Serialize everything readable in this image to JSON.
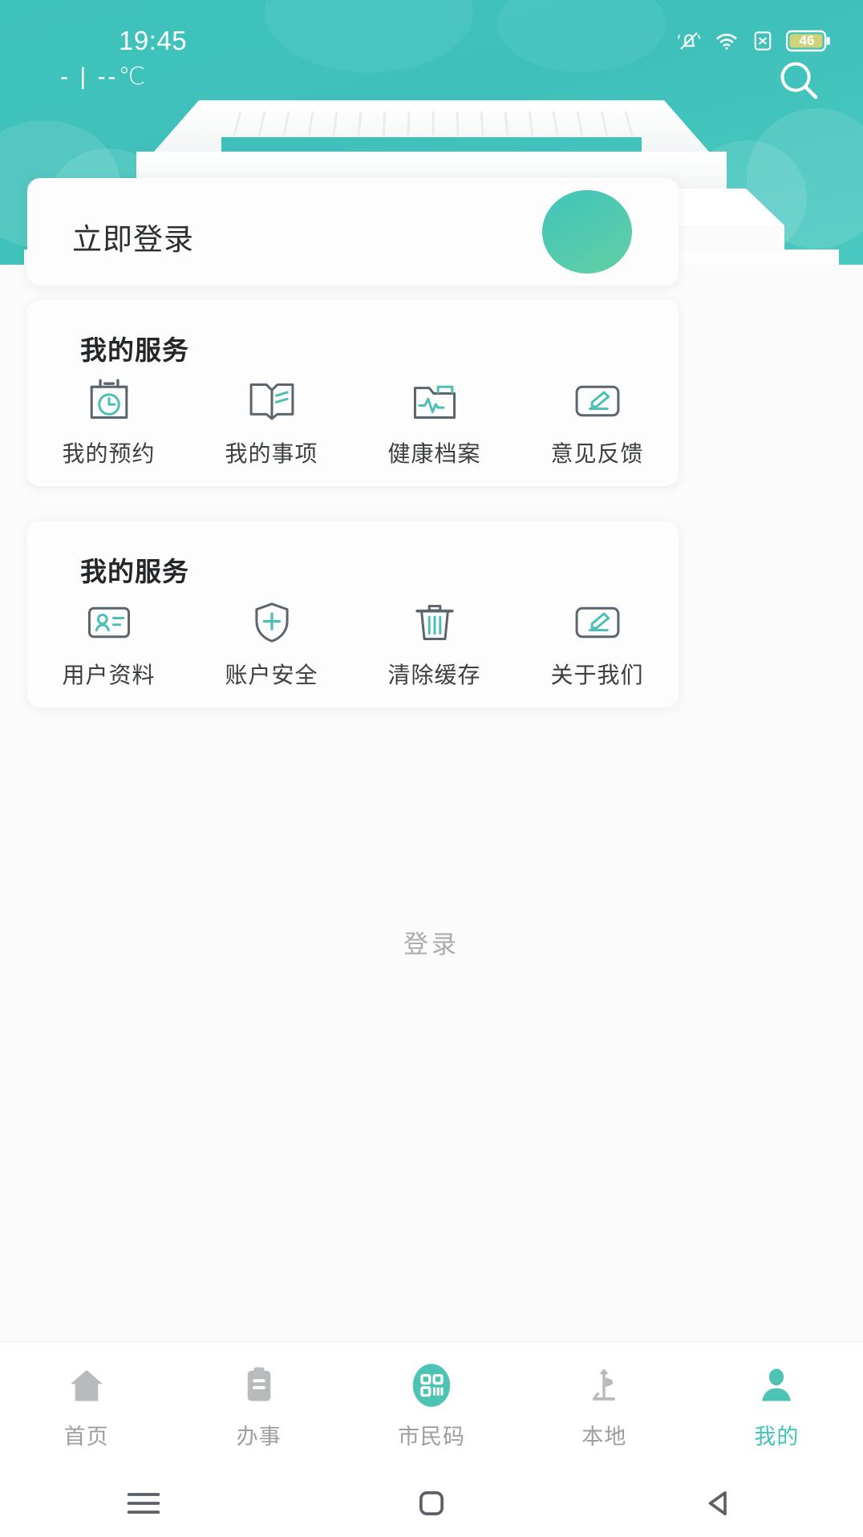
{
  "status_bar": {
    "time": "19:45",
    "battery_level": "46",
    "icons": [
      "mute-icon",
      "wifi-icon",
      "sim-card-icon",
      "battery-icon"
    ]
  },
  "header": {
    "weather": "- | --℃",
    "search_icon": "search-icon",
    "background_color": "#41c3bd",
    "decoration": "pavilion-silhouette"
  },
  "login_card": {
    "label": "立即登录",
    "avatar": "avatar-placeholder"
  },
  "services_card": {
    "title": "我的服务",
    "items": [
      {
        "label": "我的预约",
        "icon": "calendar-clock-icon"
      },
      {
        "label": "我的事项",
        "icon": "open-book-icon"
      },
      {
        "label": "健康档案",
        "icon": "folder-pulse-icon"
      },
      {
        "label": "意见反馈",
        "icon": "pencil-edit-icon"
      }
    ]
  },
  "settings_card": {
    "title": "我的服务",
    "items": [
      {
        "label": "用户资料",
        "icon": "id-card-icon"
      },
      {
        "label": "账户安全",
        "icon": "shield-plus-icon"
      },
      {
        "label": "清除缓存",
        "icon": "trash-icon"
      },
      {
        "label": "关于我们",
        "icon": "pencil-edit-icon"
      }
    ]
  },
  "login_link": {
    "label": "登录"
  },
  "tab_bar": {
    "active_index": 4,
    "accent_color": "#3fc4bb",
    "inactive_color": "#9b9fa1",
    "tabs": [
      {
        "label": "首页",
        "icon": "home-icon"
      },
      {
        "label": "办事",
        "icon": "clipboard-icon"
      },
      {
        "label": "市民码",
        "icon": "qr-code-icon"
      },
      {
        "label": "本地",
        "icon": "landmark-icon"
      },
      {
        "label": "我的",
        "icon": "person-icon"
      }
    ]
  },
  "system_nav": {
    "buttons": [
      {
        "icon": "menu-icon"
      },
      {
        "icon": "home-square-icon"
      },
      {
        "icon": "back-triangle-icon"
      }
    ]
  }
}
